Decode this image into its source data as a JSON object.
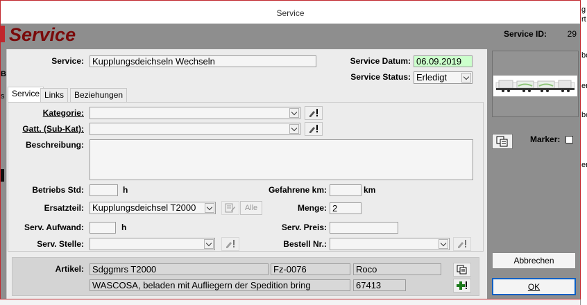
{
  "window": {
    "title": "Service"
  },
  "header": {
    "title": "Service",
    "service_id_label": "Service ID:",
    "service_id_value": "29"
  },
  "top": {
    "service_label": "Service:",
    "service_value": "Kupplungsdeichseln Wechseln",
    "datum_label": "Service Datum:",
    "datum_value": "06.09.2019",
    "status_label": "Service Status:",
    "status_value": "Erledigt"
  },
  "tabs": [
    {
      "label": "Service",
      "active": true
    },
    {
      "label": "Links",
      "active": false
    },
    {
      "label": "Beziehungen",
      "active": false
    }
  ],
  "form": {
    "kategorie_label": "Kategorie:",
    "kategorie_value": "",
    "gatt_label": "Gatt. (Sub-Kat):",
    "gatt_value": "",
    "beschreibung_label": "Beschreibung:",
    "beschreibung_value": "",
    "betriebs_label": "Betriebs Std:",
    "betriebs_value": "",
    "betriebs_unit": "h",
    "gefahrene_label": "Gefahrene km:",
    "gefahrene_value": "",
    "gefahrene_unit": "km",
    "ersatzteil_label": "Ersatzteil:",
    "ersatzteil_value": "Kupplungsdeichsel T2000",
    "alle_label": "Alle",
    "menge_label": "Menge:",
    "menge_value": "2",
    "aufwand_label": "Serv. Aufwand:",
    "aufwand_value": "",
    "aufwand_unit": "h",
    "preis_label": "Serv. Preis:",
    "preis_value": "",
    "stelle_label": "Serv. Stelle:",
    "stelle_value": "",
    "bestell_label": "Bestell Nr.:",
    "bestell_value": ""
  },
  "artikel": {
    "label": "Artikel:",
    "name": "Sdggmrs T2000",
    "nummer": "Fz-0076",
    "hersteller": "Roco",
    "beschreibung": "WASCOSA, beladen mit Aufliegern der Spedition bring",
    "artikelnr": "67413"
  },
  "side": {
    "marker_label": "Marker:",
    "cancel_label": "Abbrechen",
    "ok_label": "OK"
  },
  "background": {
    "fragments": [
      "E",
      "B",
      "s",
      "g",
      "rt",
      "bo",
      "er",
      "bo",
      "er"
    ]
  },
  "colors": {
    "window_bg": "#8e8e8e",
    "panel_bg": "#ececec",
    "title_red": "#7a0a0a",
    "date_green": "#ccffcc",
    "default_button_border": "#0a5fc4"
  },
  "icons": {
    "edit": "pencil-exclaim-icon",
    "copy": "copy-pages-icon",
    "add": "plus-exclaim-icon",
    "dropdown": "chevron-down-icon"
  }
}
